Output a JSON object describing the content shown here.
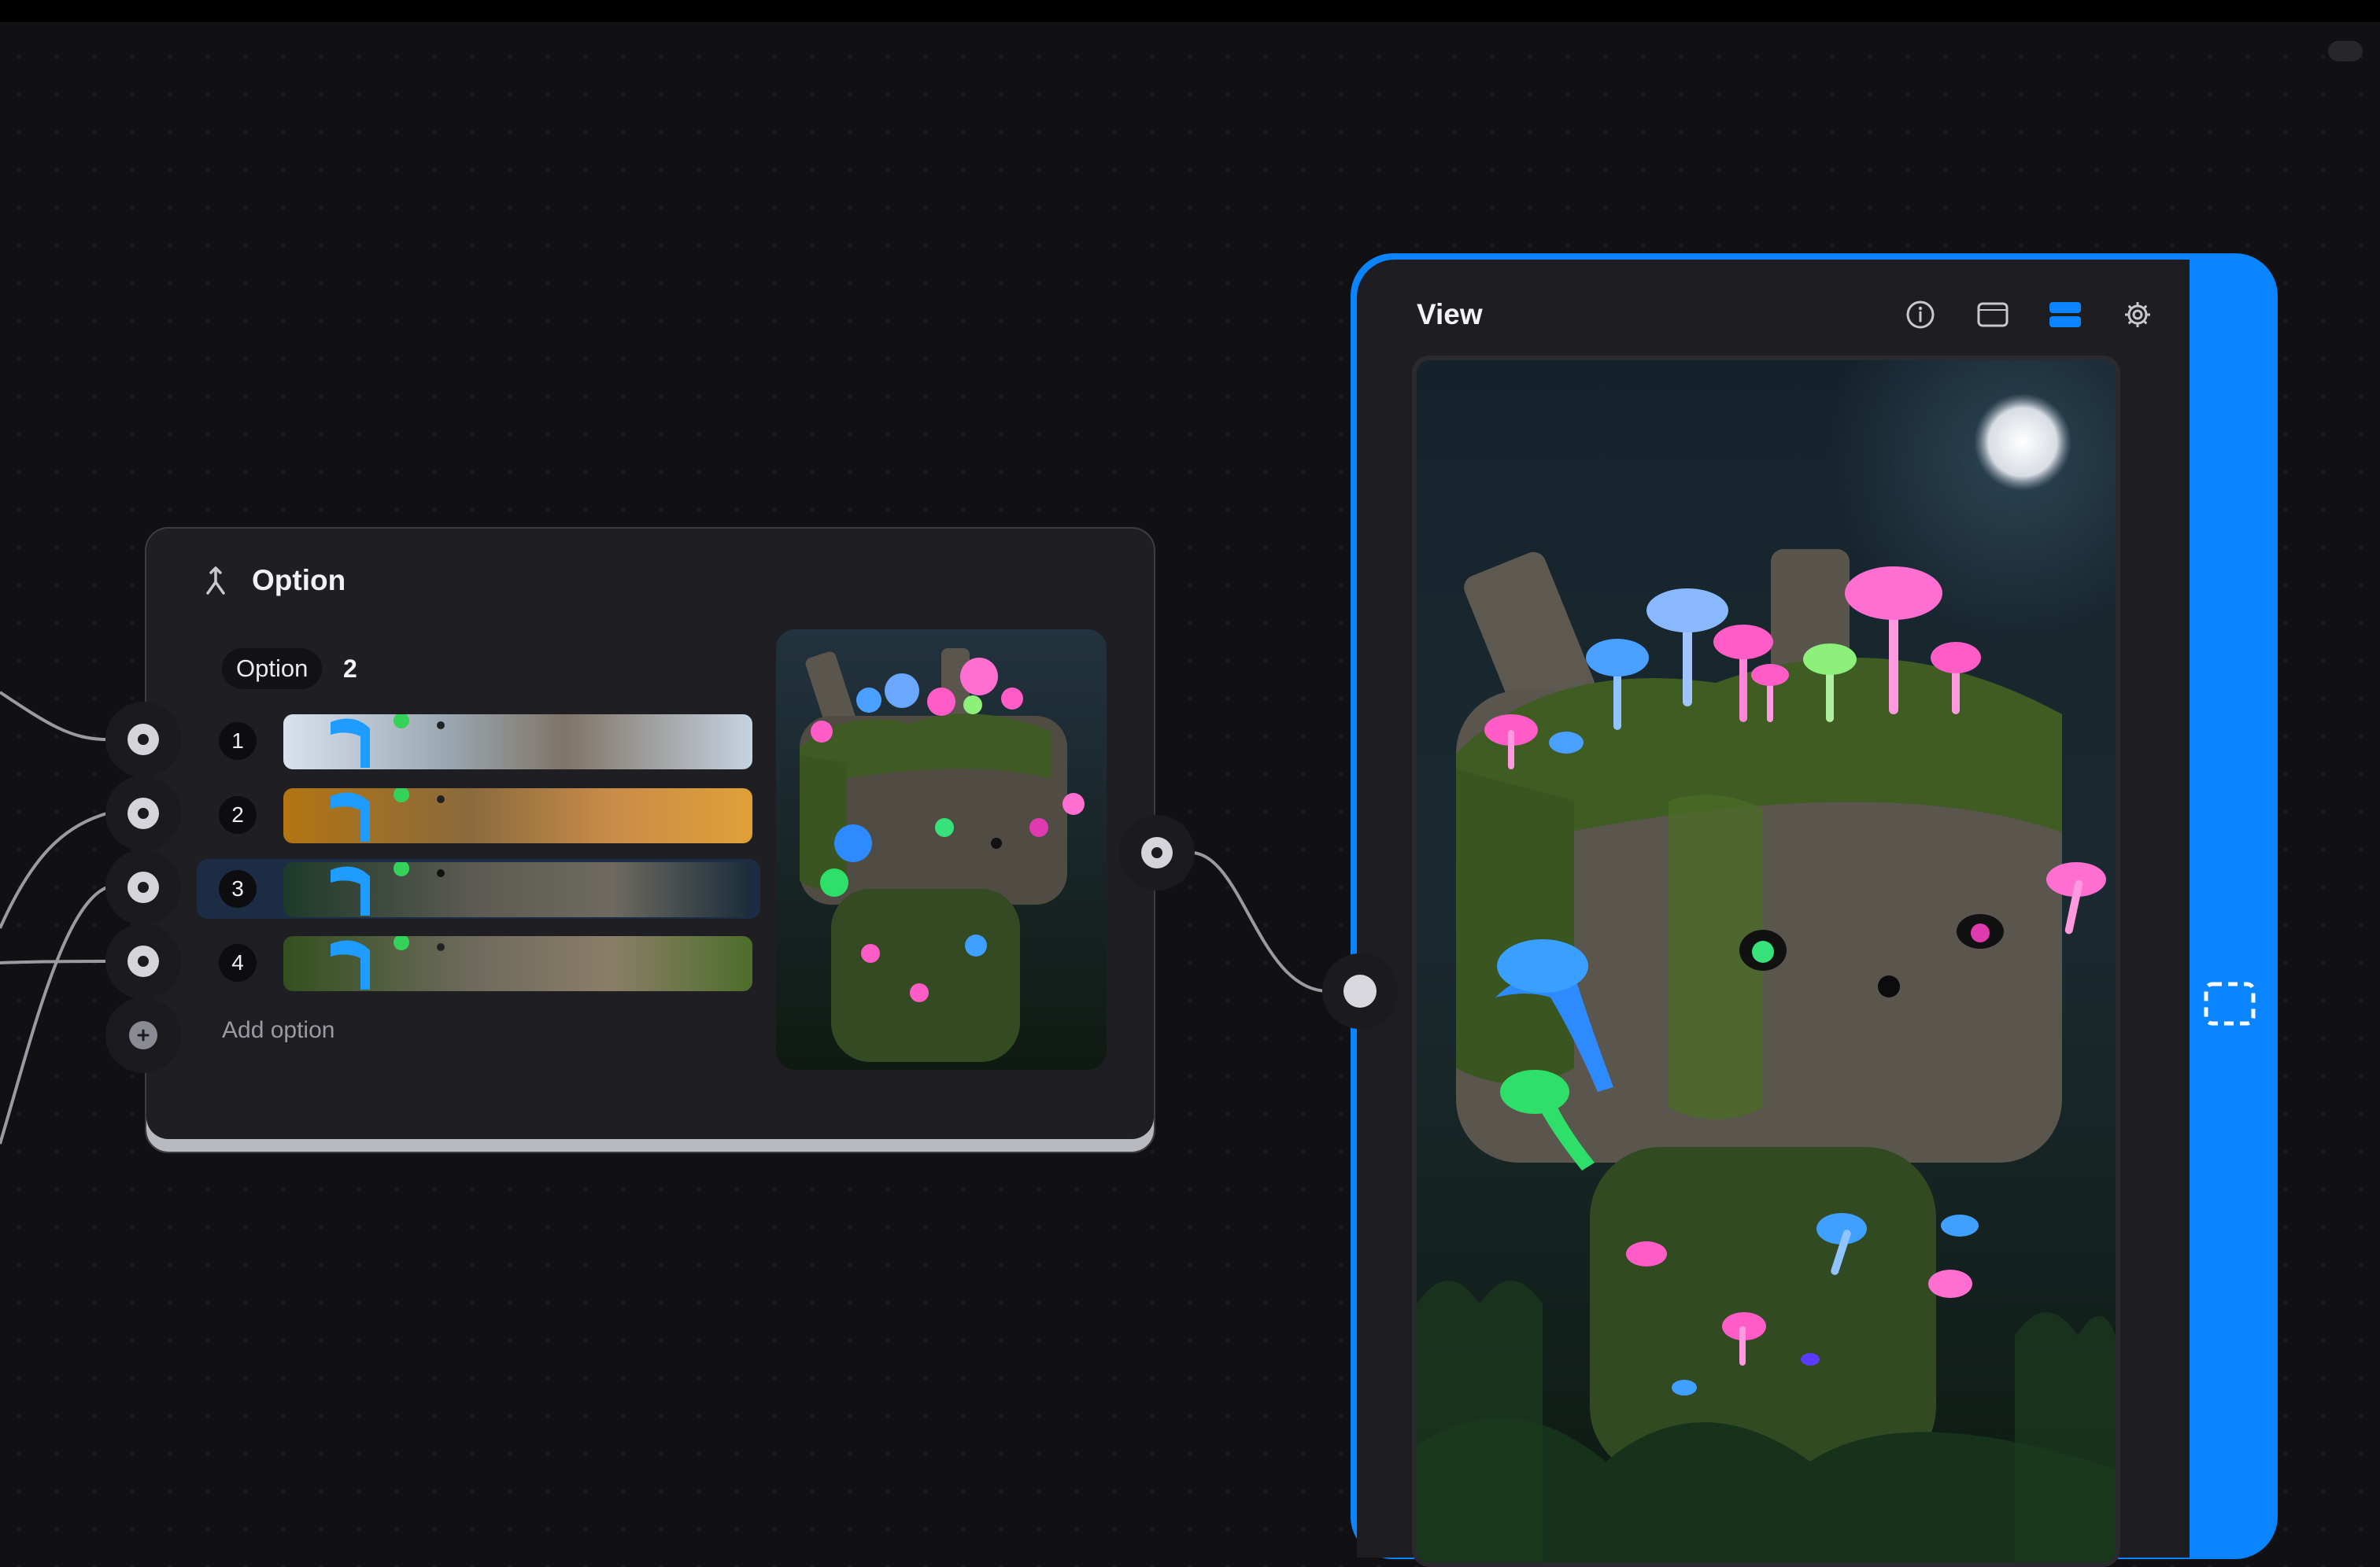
{
  "option_node": {
    "title": "Option",
    "icon": "branch-icon",
    "chip_label": "Option",
    "selected_value": "2",
    "rows": [
      {
        "number": "1",
        "thumb_tone": "#c9d6e6",
        "selected": false
      },
      {
        "number": "2",
        "thumb_tone": "#d99a2e",
        "selected": false
      },
      {
        "number": "3",
        "thumb_tone": "#1d3140",
        "selected": true
      },
      {
        "number": "4",
        "thumb_tone": "#4d6e2a",
        "selected": false
      }
    ],
    "add_option_label": "Add option"
  },
  "view_node": {
    "title": "View",
    "toolbar": {
      "icons": [
        "info-icon",
        "window-icon",
        "split-view-icon",
        "gear-icon"
      ],
      "active": "split-view-icon"
    },
    "side_icon": "marquee-select-icon"
  },
  "colors": {
    "canvas": "#111114",
    "node_bg": "#1f1f23",
    "accent": "#0a84ff",
    "selected_row": "#1c2c45"
  }
}
